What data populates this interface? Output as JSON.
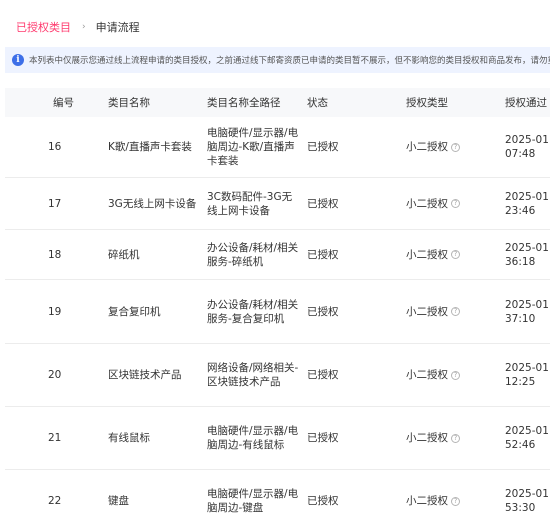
{
  "breadcrumb": {
    "active": "已授权类目",
    "separator": "›",
    "current": "申请流程"
  },
  "notice": {
    "icon": "info-icon",
    "text": "本列表中仅展示您通过线上流程申请的类目授权，之前通过线下邮寄资质已申请的类目暂不展示，但不影响您的类目授权和商品发布，请勿重复"
  },
  "table": {
    "headers": {
      "num": "编号",
      "name": "类目名称",
      "path": "类目名称全路径",
      "status": "状态",
      "type": "授权类型",
      "time": "授权通过"
    },
    "rows": [
      {
        "num": "16",
        "name": "K歌/直播声卡套装",
        "path": "电脑硬件/显示器/电脑周边-K歌/直播声卡套装",
        "status": "已授权",
        "type": "小二授权",
        "date": "2025-01",
        "clock": "07:48"
      },
      {
        "num": "17",
        "name": "3G无线上网卡设备",
        "path": "3C数码配件-3G无线上网卡设备",
        "status": "已授权",
        "type": "小二授权",
        "date": "2025-01",
        "clock": "23:46"
      },
      {
        "num": "18",
        "name": "碎纸机",
        "path": "办公设备/耗材/相关服务-碎纸机",
        "status": "已授权",
        "type": "小二授权",
        "date": "2025-01",
        "clock": "36:18"
      },
      {
        "num": "19",
        "name": "复合复印机",
        "path": "办公设备/耗材/相关服务-复合复印机",
        "status": "已授权",
        "type": "小二授权",
        "date": "2025-01",
        "clock": "37:10"
      },
      {
        "num": "20",
        "name": "区块链技术产品",
        "path": "网络设备/网络相关-区块链技术产品",
        "status": "已授权",
        "type": "小二授权",
        "date": "2025-01",
        "clock": "12:25"
      },
      {
        "num": "21",
        "name": "有线鼠标",
        "path": "电脑硬件/显示器/电脑周边-有线鼠标",
        "status": "已授权",
        "type": "小二授权",
        "date": "2025-01",
        "clock": "52:46"
      },
      {
        "num": "22",
        "name": "键盘",
        "path": "电脑硬件/显示器/电脑周边-键盘",
        "status": "已授权",
        "type": "小二授权",
        "date": "2025-01",
        "clock": "53:30"
      }
    ]
  },
  "colors": {
    "accent": "#ff3a6e",
    "notice_bg": "#eef3ff",
    "info_icon": "#3d6fe8",
    "header_bg": "#f7f8fa"
  }
}
